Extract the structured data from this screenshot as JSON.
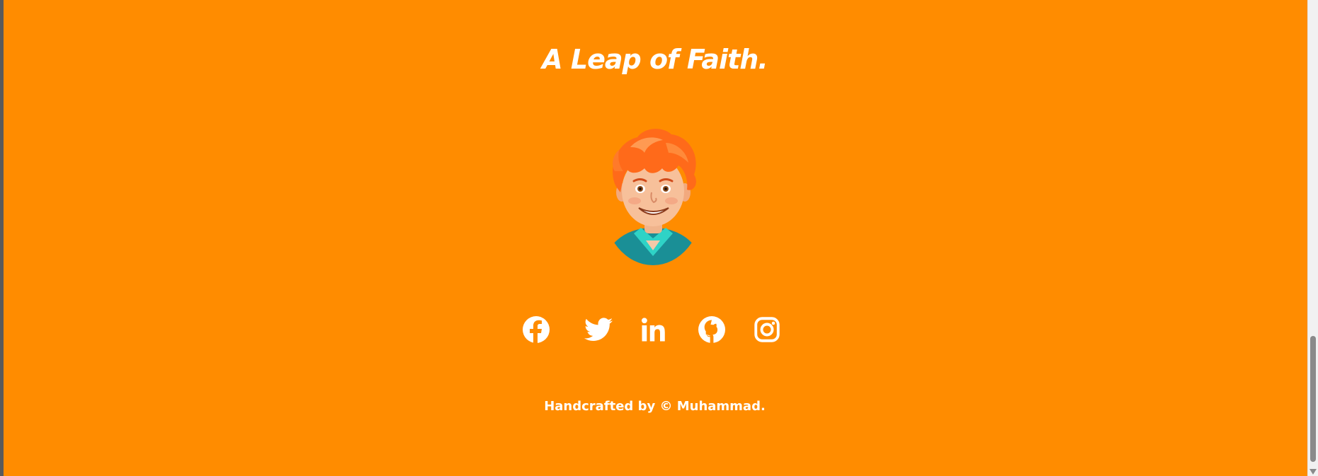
{
  "page": {
    "background_color": "#ff8c00",
    "text_color": "#ffffff"
  },
  "hero": {
    "title": "A Leap of Faith."
  },
  "avatar": {
    "icon": "cartoon-avatar-redhead-boy"
  },
  "socials": [
    {
      "name": "Facebook",
      "icon": "facebook-icon"
    },
    {
      "name": "Twitter",
      "icon": "twitter-icon"
    },
    {
      "name": "LinkedIn",
      "icon": "linkedin-icon"
    },
    {
      "name": "GitHub",
      "icon": "github-icon"
    },
    {
      "name": "Instagram",
      "icon": "instagram-icon"
    }
  ],
  "footer": {
    "credit": "Handcrafted by © Muhammad."
  }
}
